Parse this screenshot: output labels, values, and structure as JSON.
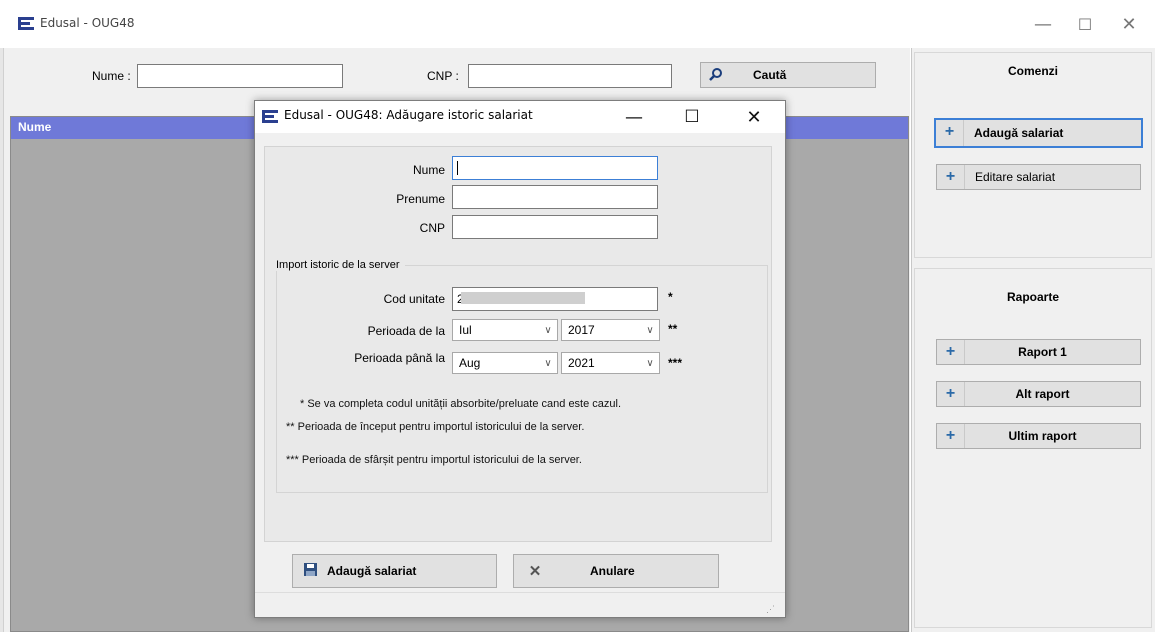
{
  "main_window": {
    "title": "Edusal - OUG48",
    "controls": {
      "minimize": "—",
      "maximize": "☐",
      "close": "✕"
    }
  },
  "search": {
    "name_label": "Nume :",
    "name_value": "",
    "cnp_label": "CNP :",
    "cnp_value": "",
    "button_label": "Caută",
    "button_icon": "search-icon"
  },
  "grid": {
    "columns": [
      "Nume"
    ]
  },
  "right_panel": {
    "commands": {
      "title": "Comenzi",
      "buttons": [
        "Adaugă salariat",
        "Editare salariat"
      ]
    },
    "reports": {
      "title": "Rapoarte",
      "buttons": [
        "Raport 1",
        "Alt raport",
        "Ultim raport"
      ]
    },
    "button_icon": "plus-icon"
  },
  "dialog": {
    "title": "Edusal - OUG48: Adăugare istoric salariat",
    "controls": {
      "minimize": "—",
      "maximize": "☐",
      "close": "✕"
    },
    "fields": {
      "nume_label": "Nume",
      "nume_value": "",
      "prenume_label": "Prenume",
      "prenume_value": "",
      "cnp_label": "CNP",
      "cnp_value": ""
    },
    "import_group": {
      "title": "Import istoric de la server",
      "cod_unitate_label": "Cod unitate",
      "cod_unitate_value": "2",
      "cod_unitate_marker": "*",
      "perioada_de_la_label": "Perioada de la",
      "perioada_de_la_month": "Iul",
      "perioada_de_la_year": "2017",
      "perioada_de_la_marker": "**",
      "perioada_pana_la_label": "Perioada până la",
      "perioada_pana_la_month": "Aug",
      "perioada_pana_la_year": "2021",
      "perioada_pana_la_marker": "***",
      "notes": [
        "* Se va completa codul unității absorbite/preluate cand este cazul.",
        "** Perioada de început pentru importul istoricului de la server.",
        "*** Perioada de sfârșit pentru importul istoricului de la server."
      ]
    },
    "buttons": {
      "save_label": "Adaugă salariat",
      "save_icon": "floppy-disk-icon",
      "cancel_label": "Anulare",
      "cancel_icon": "close-x-icon"
    }
  },
  "colors": {
    "grid_header": "#6f79d8",
    "grid_background": "#a9a9a9",
    "accent_icon": "#2b6aa8"
  }
}
